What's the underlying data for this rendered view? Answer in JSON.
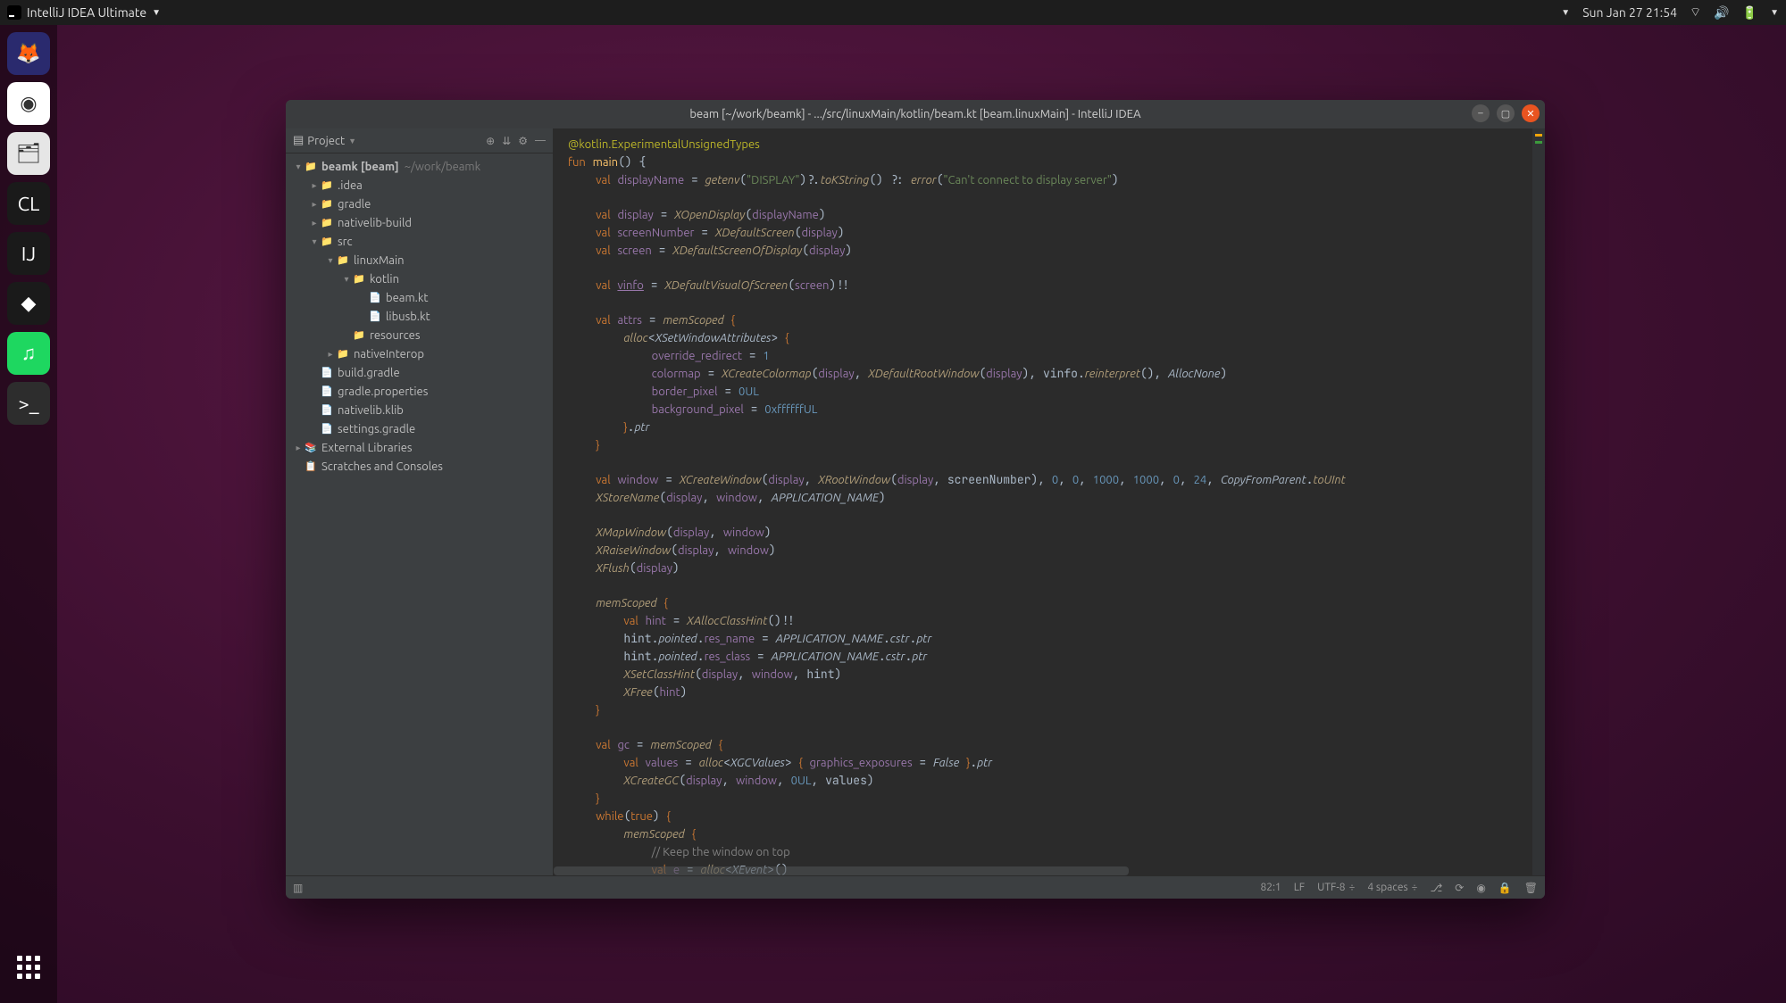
{
  "topbar": {
    "app_label": "IntelliJ IDEA Ultimate",
    "datetime": "Sun Jan 27  21:54"
  },
  "dock": {
    "items": [
      {
        "name": "firefox",
        "bg": "#2a2a6e",
        "glyph": "🦊"
      },
      {
        "name": "chrome",
        "bg": "#ffffff",
        "glyph": "◉"
      },
      {
        "name": "files",
        "bg": "#e6e6e6",
        "glyph": "🗂"
      },
      {
        "name": "clion",
        "bg": "#1a1a1a",
        "glyph": "CL"
      },
      {
        "name": "intellij",
        "bg": "#1a1a1a",
        "glyph": "IJ"
      },
      {
        "name": "toolbox",
        "bg": "#1a1a1a",
        "glyph": "◆"
      },
      {
        "name": "spotify",
        "bg": "#1ed760",
        "glyph": "♫"
      },
      {
        "name": "terminal",
        "bg": "#2d2d2d",
        "glyph": ">_"
      }
    ]
  },
  "window": {
    "title": "beam [~/work/beamk] - .../src/linuxMain/kotlin/beam.kt [beam.linuxMain] - IntelliJ IDEA"
  },
  "sidebar": {
    "label": "Project",
    "tree": [
      {
        "depth": 0,
        "arrow": "▾",
        "icon": "📁",
        "text": "beamk [beam]",
        "extra": "~/work/beamk",
        "bold": true
      },
      {
        "depth": 1,
        "arrow": "▸",
        "icon": "📁",
        "text": ".idea"
      },
      {
        "depth": 1,
        "arrow": "▸",
        "icon": "📁",
        "text": "gradle"
      },
      {
        "depth": 1,
        "arrow": "▸",
        "icon": "📁",
        "text": "nativelib-build"
      },
      {
        "depth": 1,
        "arrow": "▾",
        "icon": "📁",
        "text": "src"
      },
      {
        "depth": 2,
        "arrow": "▾",
        "icon": "📁",
        "text": "linuxMain"
      },
      {
        "depth": 3,
        "arrow": "▾",
        "icon": "📁",
        "text": "kotlin"
      },
      {
        "depth": 4,
        "arrow": "",
        "icon": "📄",
        "text": "beam.kt",
        "selected": false
      },
      {
        "depth": 4,
        "arrow": "",
        "icon": "📄",
        "text": "libusb.kt"
      },
      {
        "depth": 3,
        "arrow": "",
        "icon": "📁",
        "text": "resources"
      },
      {
        "depth": 2,
        "arrow": "▸",
        "icon": "📁",
        "text": "nativeInterop"
      },
      {
        "depth": 1,
        "arrow": "",
        "icon": "📄",
        "text": "build.gradle"
      },
      {
        "depth": 1,
        "arrow": "",
        "icon": "📄",
        "text": "gradle.properties"
      },
      {
        "depth": 1,
        "arrow": "",
        "icon": "📄",
        "text": "nativelib.klib"
      },
      {
        "depth": 1,
        "arrow": "",
        "icon": "📄",
        "text": "settings.gradle"
      },
      {
        "depth": 0,
        "arrow": "▸",
        "icon": "📚",
        "text": "External Libraries"
      },
      {
        "depth": 0,
        "arrow": "",
        "icon": "📋",
        "text": "Scratches and Consoles"
      }
    ]
  },
  "statusbar": {
    "pos": "82:1",
    "sep": "LF",
    "enc": "UTF-8",
    "indent": "4 spaces"
  },
  "code": {
    "annotation": "@kotlin.ExperimentalUnsignedTypes",
    "main_sig": "fun main() {",
    "display_literal": "\"DISPLAY\"",
    "err_literal": "\"Can't connect to display server\"",
    "app_name_const": "APPLICATION_NAME",
    "bg_pixel": "0xffffffUL",
    "zero_ul": "0UL",
    "one": "1",
    "nums": {
      "z": "0",
      "k1": "1000",
      "d24": "24"
    },
    "bool_true": "true",
    "bool_false": "False",
    "comment_keep": "// Keep the window on top"
  }
}
